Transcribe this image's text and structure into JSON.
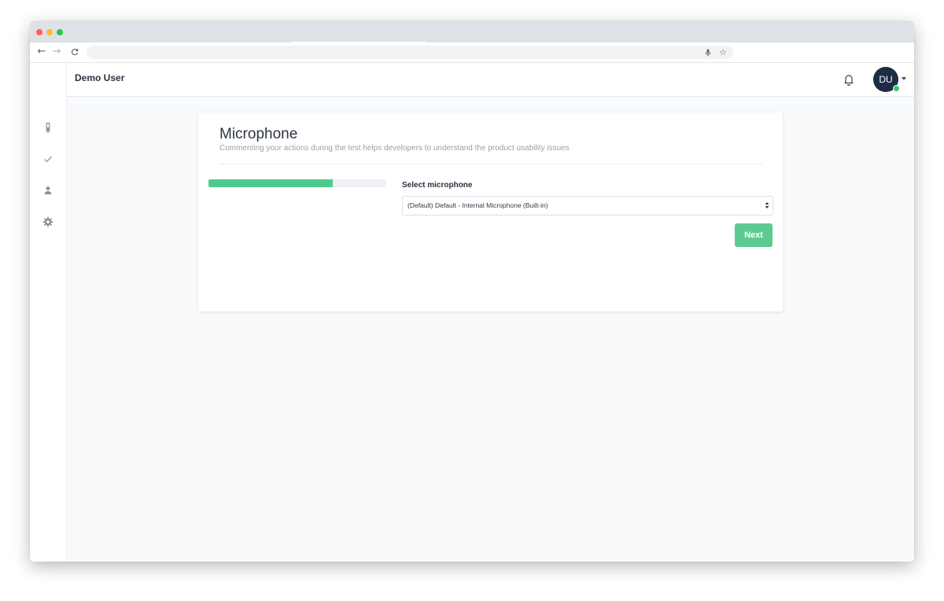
{
  "browser": {
    "back_icon": "←",
    "forward_icon": "→",
    "reload_icon": "C",
    "mic_icon": "🎙",
    "star_icon": "☆"
  },
  "header": {
    "title": "Demo User",
    "avatar_initials": "DU",
    "status_color": "#3fc66e"
  },
  "sidebar": {
    "items": [
      {
        "icon": "test-tube-icon"
      },
      {
        "icon": "check-icon"
      },
      {
        "icon": "user-icon"
      },
      {
        "icon": "gear-icon"
      }
    ]
  },
  "card": {
    "title": "Microphone",
    "subtitle": "Commenting your actions during the test helps developers to understand the product usability issues",
    "progress_percent": 70,
    "field_label": "Select microphone",
    "selected_option": "(Default) Default - Internal Microphone (Built-in)",
    "next_label": "Next"
  },
  "colors": {
    "accent": "#5ccb93",
    "progress": "#4fca8f",
    "avatar_bg": "#1d2b45"
  }
}
